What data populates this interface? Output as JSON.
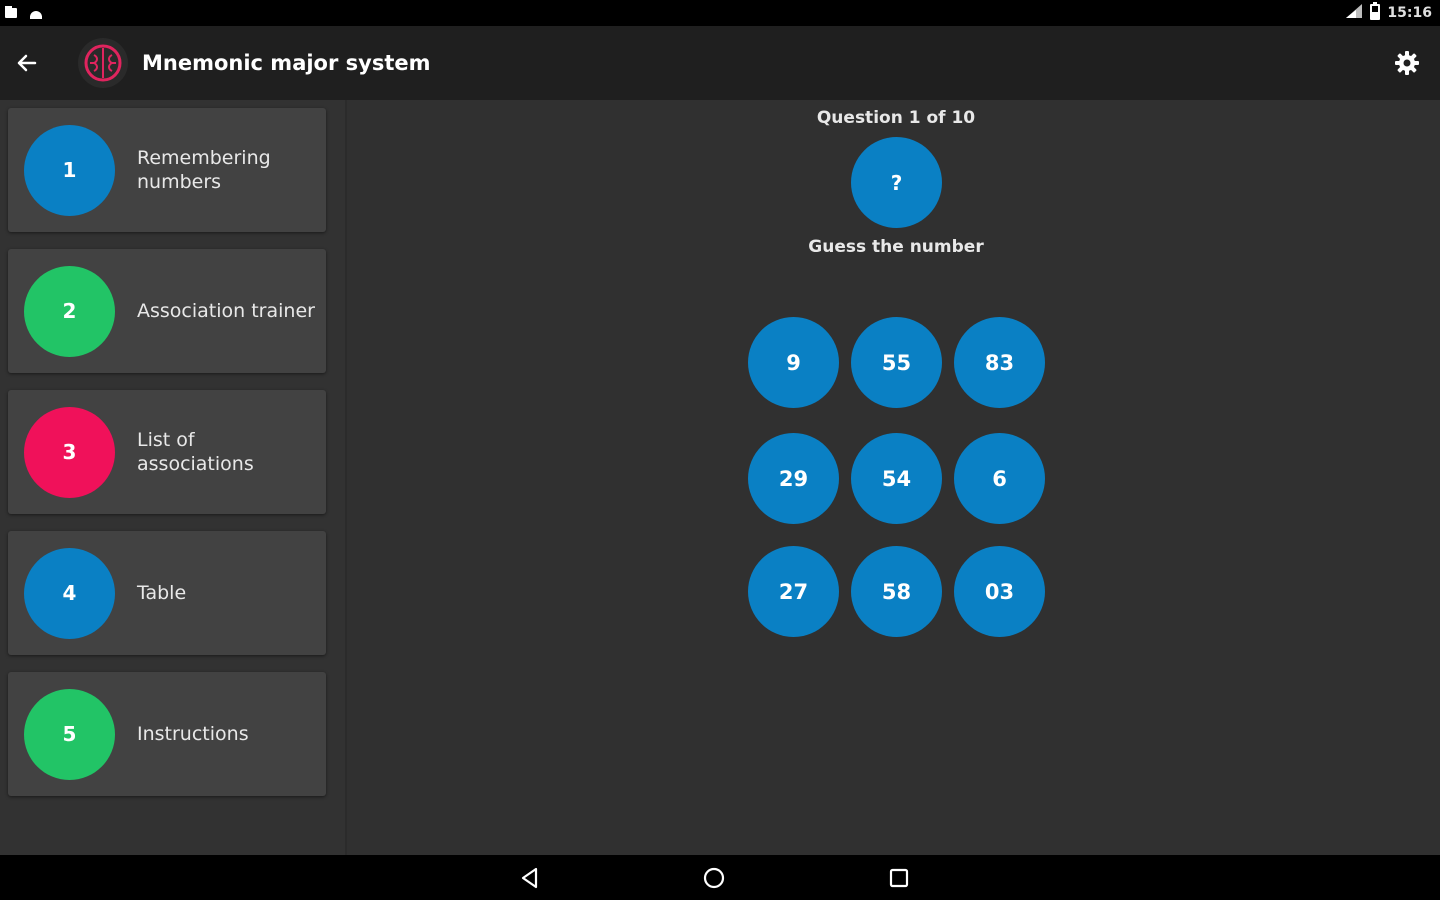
{
  "status_bar": {
    "time": "15:16"
  },
  "app_bar": {
    "title": "Mnemonic major system"
  },
  "sidebar": {
    "items": [
      {
        "number": "1",
        "label": "Remembering numbers",
        "color": "#0a80c4"
      },
      {
        "number": "2",
        "label": "Association trainer",
        "color": "#22c466"
      },
      {
        "number": "3",
        "label": "List of associations",
        "color": "#f0115a"
      },
      {
        "number": "4",
        "label": "Table",
        "color": "#0a80c4"
      },
      {
        "number": "5",
        "label": "Instructions",
        "color": "#22c466"
      }
    ]
  },
  "quiz": {
    "question_label": "Question 1 of 10",
    "question_symbol": "?",
    "prompt": "Guess the number",
    "options": [
      "9",
      "55",
      "83",
      "29",
      "54",
      "6",
      "27",
      "58",
      "03"
    ],
    "option_color": "#0a80c4"
  },
  "colors": {
    "appbar": "#1f1f1f",
    "background": "#303030",
    "card": "#424242",
    "accent": "#0a80c4",
    "logo": "#e0245e"
  }
}
